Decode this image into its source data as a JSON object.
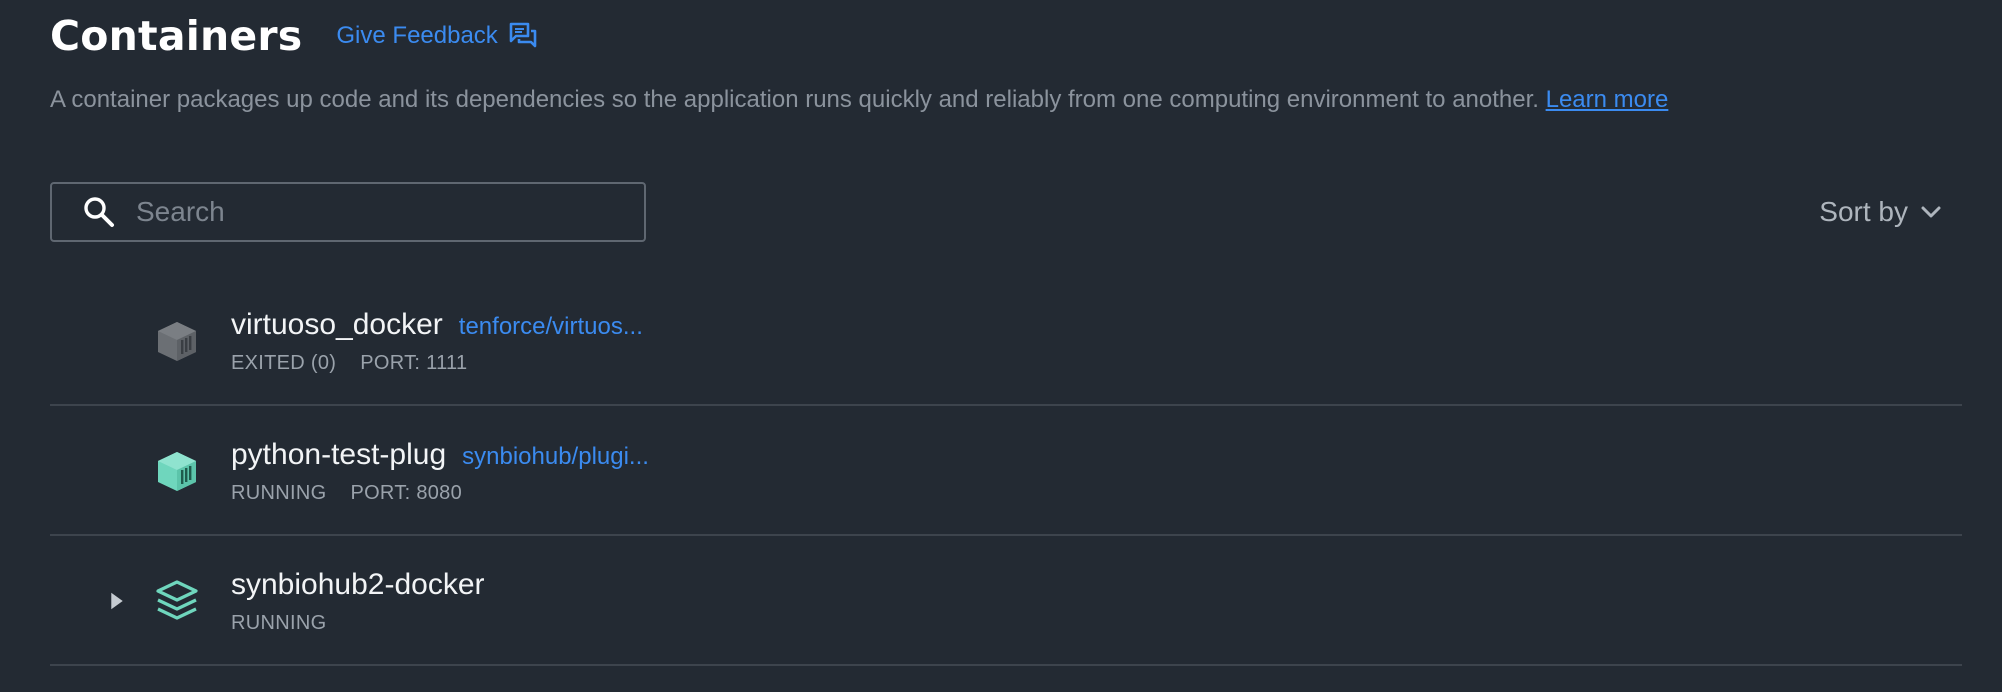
{
  "header": {
    "title": "Containers",
    "feedback_label": "Give Feedback"
  },
  "description": {
    "text": "A container packages up code and its dependencies so the application runs quickly and reliably from one computing environment to another.",
    "link_label": "Learn more"
  },
  "search": {
    "placeholder": "Search",
    "value": ""
  },
  "sort": {
    "label": "Sort by"
  },
  "containers": [
    {
      "name": "virtuoso_docker",
      "image": "tenforce/virtuos...",
      "status": "EXITED (0)",
      "port": "PORT: 1111",
      "icon": "container-exited-icon",
      "icon_color": "#6b6f74"
    },
    {
      "name": "python-test-plug",
      "image": "synbiohub/plugi...",
      "status": "RUNNING",
      "port": "PORT: 8080",
      "icon": "container-running-icon",
      "icon_color": "#6fd6bd"
    },
    {
      "name": "synbiohub2-docker",
      "image": "",
      "status": "RUNNING",
      "port": "",
      "icon": "compose-stack-icon",
      "icon_color": "#6fd6bd",
      "expandable": true
    }
  ],
  "colors": {
    "background": "#232a33",
    "accent": "#3b8bf0",
    "running": "#6fd6bd",
    "exited": "#6b6f74"
  }
}
